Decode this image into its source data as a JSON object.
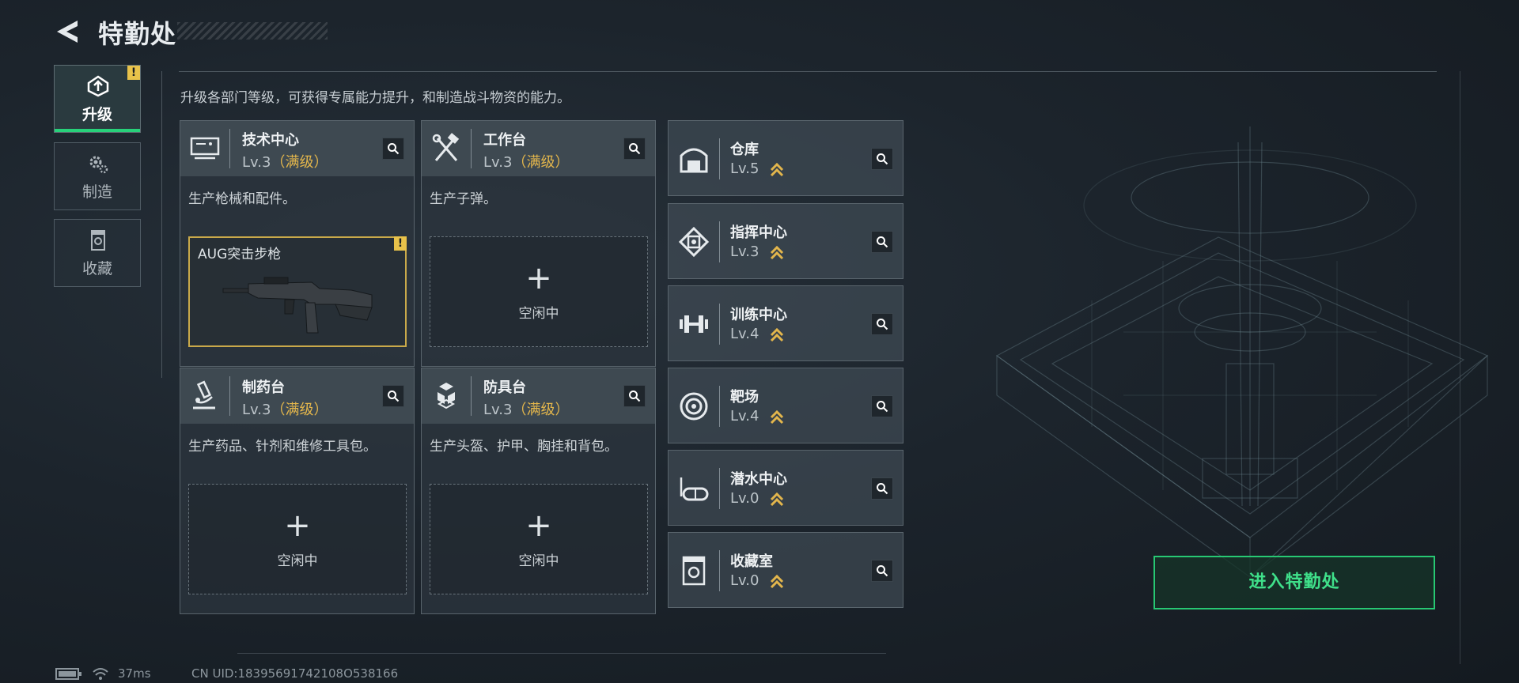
{
  "header": {
    "title": "特勤处"
  },
  "nav": {
    "items": [
      {
        "label": "升级",
        "icon": "upgrade-icon",
        "active": true,
        "warning": "!"
      },
      {
        "label": "制造",
        "icon": "gear-icon",
        "active": false
      },
      {
        "label": "收藏",
        "icon": "trophy-icon",
        "active": false
      }
    ]
  },
  "description": "升级各部门等级，可获得专属能力提升，和制造战斗物资的能力。",
  "departments": [
    {
      "name": "技术中心",
      "level": "Lv.3",
      "max_text": "（满级）",
      "desc": "生产枪械和配件。",
      "icon": "computer-icon",
      "slot": {
        "status": "filled",
        "item": "AUG突击步枪",
        "warning": "!"
      }
    },
    {
      "name": "工作台",
      "level": "Lv.3",
      "max_text": "（满级）",
      "desc": "生产子弹。",
      "icon": "tools-icon",
      "slot": {
        "status": "empty",
        "plus": "+",
        "idle": "空闲中"
      }
    },
    {
      "name": "制药台",
      "level": "Lv.3",
      "max_text": "（满级）",
      "desc": "生产药品、针剂和维修工具包。",
      "icon": "microscope-icon",
      "slot": {
        "status": "empty",
        "plus": "+",
        "idle": "空闲中"
      }
    },
    {
      "name": "防具台",
      "level": "Lv.3",
      "max_text": "（满级）",
      "desc": "生产头盔、护甲、胸挂和背包。",
      "icon": "armor-icon",
      "slot": {
        "status": "empty",
        "plus": "+",
        "idle": "空闲中"
      }
    }
  ],
  "facilities": [
    {
      "name": "仓库",
      "level": "Lv.5",
      "icon": "warehouse-icon"
    },
    {
      "name": "指挥中心",
      "level": "Lv.3",
      "icon": "command-icon"
    },
    {
      "name": "训练中心",
      "level": "Lv.4",
      "icon": "dumbbell-icon"
    },
    {
      "name": "靶场",
      "level": "Lv.4",
      "icon": "target-icon"
    },
    {
      "name": "潜水中心",
      "level": "Lv.0",
      "icon": "goggles-icon"
    },
    {
      "name": "收藏室",
      "level": "Lv.0",
      "icon": "vault-icon"
    }
  ],
  "enter_button": "进入特勤处",
  "status": {
    "ping": "37ms",
    "uid": "CN UID:18395691742108O538166"
  },
  "colors": {
    "accent": "#27d17a",
    "gold": "#e3b64c",
    "warning": "#e8c24a"
  }
}
